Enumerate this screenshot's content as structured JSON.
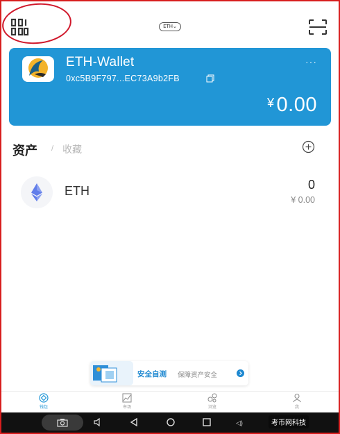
{
  "header": {
    "network_badge": "ETH",
    "icons": {
      "menu": "menu-grid-icon",
      "scan": "scan-icon"
    }
  },
  "wallet": {
    "name": "ETH-Wallet",
    "address": "0xc5B9F797...EC73A9b2FB",
    "balance_currency": "¥",
    "balance": "0.00",
    "more": "···",
    "card_color": "#2196d6"
  },
  "assets": {
    "tab_assets": "资产",
    "tab_separator": "/",
    "tab_collect": "收藏",
    "items": [
      {
        "name": "ETH",
        "quantity": "0",
        "value": "¥ 0.00"
      }
    ]
  },
  "banner": {
    "title": "安全自测",
    "subtitle": "保障资产安全"
  },
  "tabbar": {
    "items": [
      {
        "label": "钱包",
        "icon": "wallet-icon",
        "active": true
      },
      {
        "label": "市场",
        "icon": "market-chart-icon",
        "active": false
      },
      {
        "label": "浏览",
        "icon": "discover-icon",
        "active": false
      },
      {
        "label": "我",
        "icon": "profile-icon",
        "active": false
      }
    ]
  },
  "watermark": "考币网科技"
}
